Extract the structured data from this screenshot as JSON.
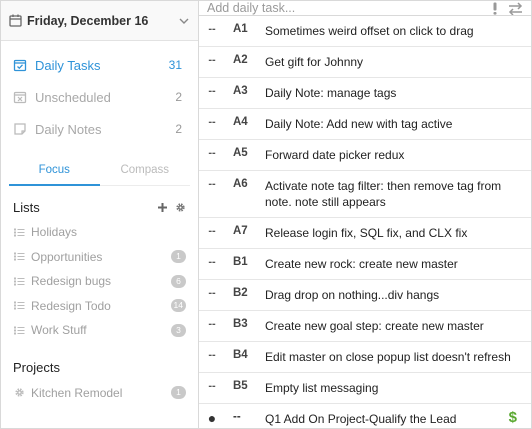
{
  "sidebar": {
    "date_label": "Friday, December 16",
    "views": [
      {
        "label": "Daily Tasks",
        "count": "31",
        "icon": "calendar-check-icon"
      },
      {
        "label": "Unscheduled",
        "count": "2",
        "icon": "calendar-x-icon"
      },
      {
        "label": "Daily Notes",
        "count": "2",
        "icon": "note-icon"
      }
    ],
    "tabs": [
      {
        "label": "Focus"
      },
      {
        "label": "Compass"
      }
    ],
    "lists_title": "Lists",
    "lists": [
      {
        "label": "Holidays",
        "badge": ""
      },
      {
        "label": "Opportunities",
        "badge": "1"
      },
      {
        "label": "Redesign bugs",
        "badge": "6"
      },
      {
        "label": "Redesign Todo",
        "badge": "14"
      },
      {
        "label": "Work Stuff",
        "badge": "3"
      }
    ],
    "projects_title": "Projects",
    "projects": [
      {
        "label": "Kitchen Remodel",
        "badge": "1"
      }
    ]
  },
  "main": {
    "add_placeholder": "Add daily task...",
    "tasks": [
      {
        "marker": "--",
        "priority": "A1",
        "text": "Sometimes weird offset on click to drag"
      },
      {
        "marker": "--",
        "priority": "A2",
        "text": "Get gift for Johnny"
      },
      {
        "marker": "--",
        "priority": "A3",
        "text": "Daily Note: manage tags"
      },
      {
        "marker": "--",
        "priority": "A4",
        "text": "Daily Note: Add new with tag active"
      },
      {
        "marker": "--",
        "priority": "A5",
        "text": "Forward date picker redux"
      },
      {
        "marker": "--",
        "priority": "A6",
        "text": "Activate note tag filter: then remove tag from note. note still appears"
      },
      {
        "marker": "--",
        "priority": "A7",
        "text": "Release login fix, SQL fix, and CLX fix"
      },
      {
        "marker": "--",
        "priority": "B1",
        "text": "Create new rock: create new master"
      },
      {
        "marker": "--",
        "priority": "B2",
        "text": "Drag drop on nothing...div hangs"
      },
      {
        "marker": "--",
        "priority": "B3",
        "text": "Create new goal step: create new master"
      },
      {
        "marker": "--",
        "priority": "B4",
        "text": "Edit master on close popup list doesn't refresh"
      },
      {
        "marker": "--",
        "priority": "B5",
        "text": "Empty list messaging"
      }
    ],
    "bullet_task": {
      "marker": "●",
      "priority": "--",
      "text": "Q1 Add On Project-Qualify the Lead",
      "icon": "dollar-icon",
      "icon_glyph": "$"
    }
  },
  "colors": {
    "accent": "#2f93d8",
    "money": "#5aa830",
    "badge": "#c9c9c9"
  }
}
